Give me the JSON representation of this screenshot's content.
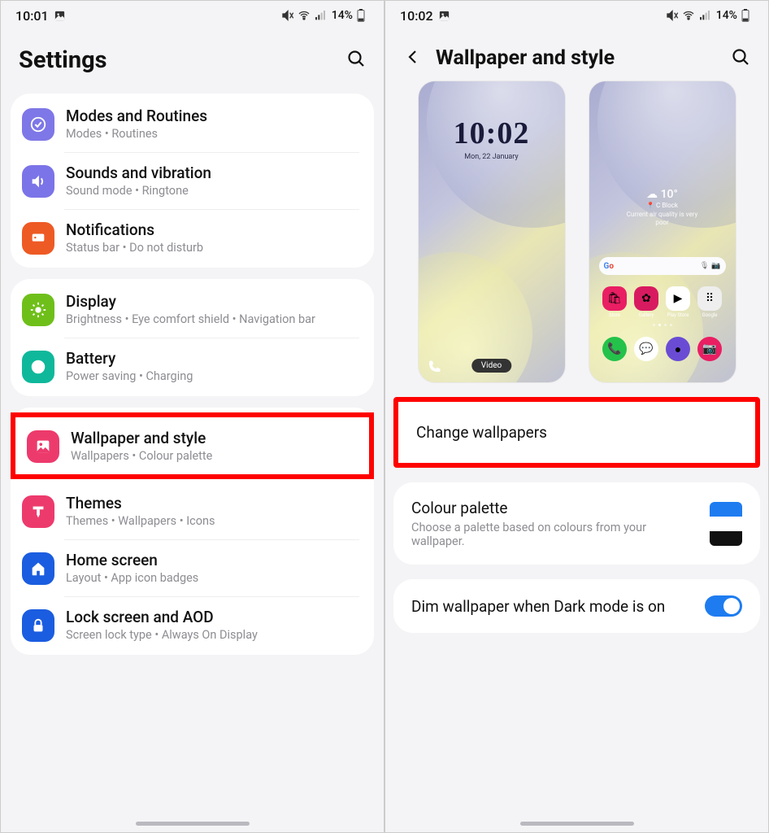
{
  "statusBar1": {
    "time": "10:01",
    "battery": "14%"
  },
  "statusBar2": {
    "time": "10:02",
    "battery": "14%"
  },
  "screen1": {
    "title": "Settings",
    "groups": [
      [
        {
          "id": "modes",
          "title": "Modes and Routines",
          "sub": "Modes  •  Routines",
          "color": "#7e77e7",
          "icon": "check"
        },
        {
          "id": "sounds",
          "title": "Sounds and vibration",
          "sub": "Sound mode  •  Ringtone",
          "color": "#7b74e8",
          "icon": "sound"
        },
        {
          "id": "notifications",
          "title": "Notifications",
          "sub": "Status bar  •  Do not disturb",
          "color": "#ee5a24",
          "icon": "bell"
        }
      ],
      [
        {
          "id": "display",
          "title": "Display",
          "sub": "Brightness  •  Eye comfort shield  •  Navigation bar",
          "color": "#6fbf1a",
          "icon": "sun"
        },
        {
          "id": "battery",
          "title": "Battery",
          "sub": "Power saving  •  Charging",
          "color": "#0fb89b",
          "icon": "battery"
        }
      ],
      [
        {
          "id": "wallpaper",
          "title": "Wallpaper and style",
          "sub": "Wallpapers  •  Colour palette",
          "color": "#ed3a6c",
          "icon": "image",
          "highlight": true
        },
        {
          "id": "themes",
          "title": "Themes",
          "sub": "Themes  •  Wallpapers  •  Icons",
          "color": "#ed3a6c",
          "icon": "brush"
        },
        {
          "id": "homescreen",
          "title": "Home screen",
          "sub": "Layout  •  App icon badges",
          "color": "#1b5de0",
          "icon": "home"
        },
        {
          "id": "lockscreen",
          "title": "Lock screen and AOD",
          "sub": "Screen lock type  •  Always On Display",
          "color": "#1b5de0",
          "icon": "lock"
        }
      ]
    ]
  },
  "screen2": {
    "title": "Wallpaper and style",
    "lock": {
      "time": "10:02",
      "date": "Mon, 22 January",
      "chip": "Video"
    },
    "home": {
      "weather_temp": "10°",
      "weather_loc": "C Block",
      "weather_note": "Current air quality is very poor",
      "apps1": [
        {
          "label": "Store",
          "color": "#e91e63",
          "glyph": "🛍"
        },
        {
          "label": "Gallery",
          "color": "#d81b60",
          "glyph": "✿"
        },
        {
          "label": "Play Store",
          "color": "#fff",
          "glyph": "▶"
        },
        {
          "label": "Google",
          "color": "#eee",
          "glyph": "⠿"
        }
      ],
      "apps2": [
        {
          "label": "",
          "color": "#24c24a",
          "glyph": "📞"
        },
        {
          "label": "",
          "color": "#fff",
          "glyph": "💬"
        },
        {
          "label": "",
          "color": "#6a4cd4",
          "glyph": "●"
        },
        {
          "label": "",
          "color": "#e91e63",
          "glyph": "📷"
        }
      ]
    },
    "change_label": "Change wallpapers",
    "palette": {
      "title": "Colour palette",
      "sub": "Choose a palette based on colours from your wallpaper.",
      "colors": [
        "#1e7cf0",
        "#ffffff",
        "#111111"
      ]
    },
    "dim": {
      "title": "Dim wallpaper when Dark mode is on",
      "on": true
    }
  }
}
